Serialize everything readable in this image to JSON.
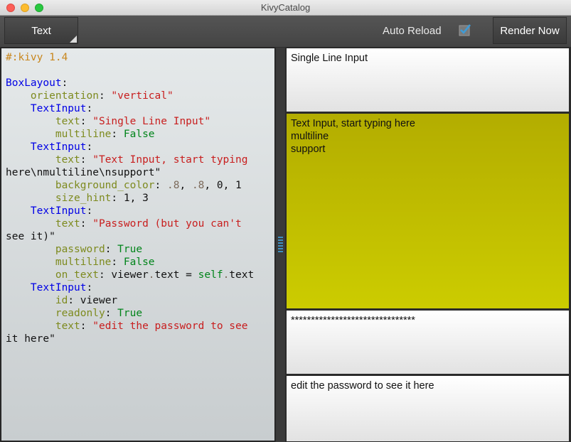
{
  "window": {
    "title": "KivyCatalog"
  },
  "toolbar": {
    "text_button": "Text",
    "auto_reload_label": "Auto Reload",
    "auto_reload_checked": true,
    "render_button": "Render Now"
  },
  "editor": {
    "lines": [
      [
        {
          "t": "#:kivy 1.4",
          "c": "comment"
        }
      ],
      [],
      [
        {
          "t": "BoxLayout",
          "c": "class"
        },
        {
          "t": ":",
          "c": ""
        }
      ],
      [
        {
          "t": "    ",
          "c": ""
        },
        {
          "t": "orientation",
          "c": "prop"
        },
        {
          "t": ": ",
          "c": ""
        },
        {
          "t": "\"vertical\"",
          "c": "str"
        }
      ],
      [
        {
          "t": "    ",
          "c": ""
        },
        {
          "t": "TextInput",
          "c": "class"
        },
        {
          "t": ":",
          "c": ""
        }
      ],
      [
        {
          "t": "        ",
          "c": ""
        },
        {
          "t": "text",
          "c": "prop"
        },
        {
          "t": ": ",
          "c": ""
        },
        {
          "t": "\"Single Line Input\"",
          "c": "str"
        }
      ],
      [
        {
          "t": "        ",
          "c": ""
        },
        {
          "t": "multiline",
          "c": "prop"
        },
        {
          "t": ": ",
          "c": ""
        },
        {
          "t": "False",
          "c": "const"
        }
      ],
      [
        {
          "t": "    ",
          "c": ""
        },
        {
          "t": "TextInput",
          "c": "class"
        },
        {
          "t": ":",
          "c": ""
        }
      ],
      [
        {
          "t": "        ",
          "c": ""
        },
        {
          "t": "text",
          "c": "prop"
        },
        {
          "t": ": ",
          "c": ""
        },
        {
          "t": "\"Text Input, start typing",
          "c": "str"
        }
      ],
      [
        {
          "t": "here\\nmultiline\\nsupport\"",
          "c": ""
        }
      ],
      [
        {
          "t": "        ",
          "c": ""
        },
        {
          "t": "background_color",
          "c": "prop"
        },
        {
          "t": ": ",
          "c": ""
        },
        {
          "t": ".8",
          "c": "num"
        },
        {
          "t": ", ",
          "c": ""
        },
        {
          "t": ".8",
          "c": "num"
        },
        {
          "t": ", 0, 1",
          "c": ""
        }
      ],
      [
        {
          "t": "        ",
          "c": ""
        },
        {
          "t": "size_hint",
          "c": "prop"
        },
        {
          "t": ": 1, 3",
          "c": ""
        }
      ],
      [
        {
          "t": "    ",
          "c": ""
        },
        {
          "t": "TextInput",
          "c": "class"
        },
        {
          "t": ":",
          "c": ""
        }
      ],
      [
        {
          "t": "        ",
          "c": ""
        },
        {
          "t": "text",
          "c": "prop"
        },
        {
          "t": ": ",
          "c": ""
        },
        {
          "t": "\"Password (but you can't",
          "c": "str"
        }
      ],
      [
        {
          "t": "see it)\"",
          "c": ""
        }
      ],
      [
        {
          "t": "        ",
          "c": ""
        },
        {
          "t": "password",
          "c": "prop"
        },
        {
          "t": ": ",
          "c": ""
        },
        {
          "t": "True",
          "c": "const"
        }
      ],
      [
        {
          "t": "        ",
          "c": ""
        },
        {
          "t": "multiline",
          "c": "prop"
        },
        {
          "t": ": ",
          "c": ""
        },
        {
          "t": "False",
          "c": "const"
        }
      ],
      [
        {
          "t": "        ",
          "c": ""
        },
        {
          "t": "on_text",
          "c": "prop"
        },
        {
          "t": ": viewer",
          "c": ""
        },
        {
          "t": ".",
          "c": "num"
        },
        {
          "t": "text = ",
          "c": ""
        },
        {
          "t": "self",
          "c": "self"
        },
        {
          "t": ".",
          "c": "num"
        },
        {
          "t": "text",
          "c": ""
        }
      ],
      [
        {
          "t": "    ",
          "c": ""
        },
        {
          "t": "TextInput",
          "c": "class"
        },
        {
          "t": ":",
          "c": ""
        }
      ],
      [
        {
          "t": "        ",
          "c": ""
        },
        {
          "t": "id",
          "c": "prop"
        },
        {
          "t": ": viewer",
          "c": ""
        }
      ],
      [
        {
          "t": "        ",
          "c": ""
        },
        {
          "t": "readonly",
          "c": "prop"
        },
        {
          "t": ": ",
          "c": ""
        },
        {
          "t": "True",
          "c": "const"
        }
      ],
      [
        {
          "t": "        ",
          "c": ""
        },
        {
          "t": "text",
          "c": "prop"
        },
        {
          "t": ": ",
          "c": ""
        },
        {
          "t": "\"edit the password to see",
          "c": "str"
        }
      ],
      [
        {
          "t": "it here\"",
          "c": ""
        }
      ]
    ]
  },
  "preview": {
    "single_line": "Single Line Input",
    "multiline": "Text Input, start typing here\nmultiline\nsupport",
    "password_masked": "*******************************",
    "viewer": "edit the password to see it here"
  },
  "colors": {
    "multiline_background": "#cccc00",
    "checkbox_accent": "#3f9bd6"
  }
}
